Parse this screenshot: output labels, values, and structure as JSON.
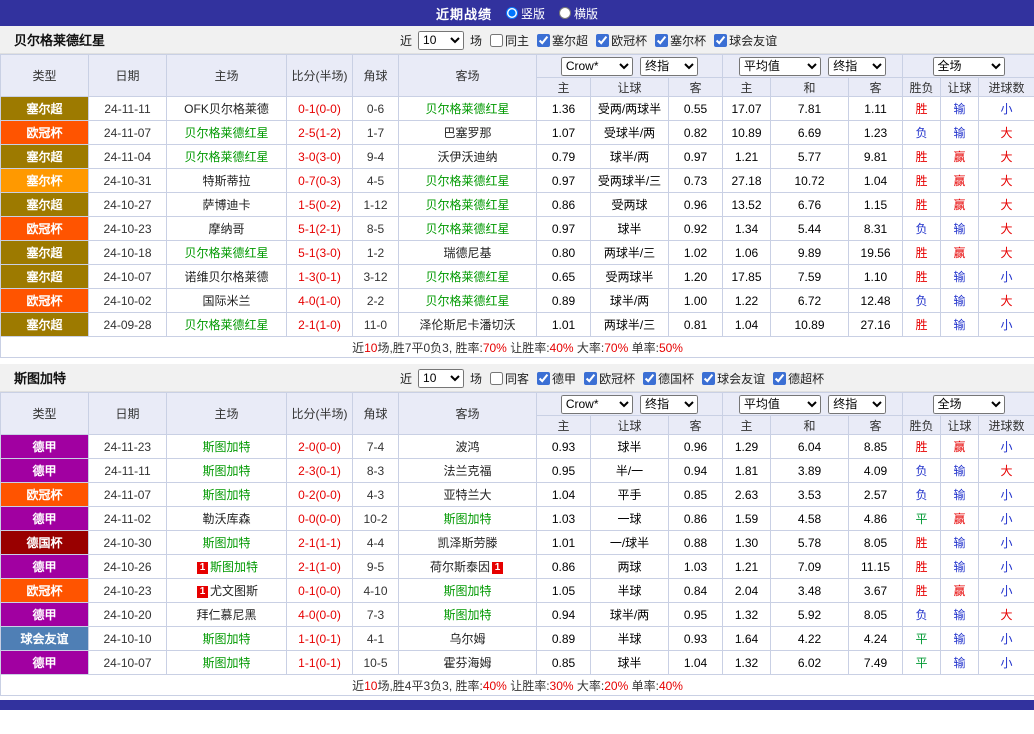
{
  "topbar": {
    "title": "近期战绩",
    "vertical": "竖版",
    "horizontal": "横版"
  },
  "card_text": "1",
  "colors": {
    "league": {
      "塞尔超": "#9d7a00",
      "欧冠杯": "#ff5400",
      "塞尔杯": "#ff9900",
      "德甲": "#a100a1",
      "德国杯": "#990000",
      "球会友谊": "#4f7fb5"
    },
    "result": {
      "胜": "#e60000",
      "负": "#2233cc",
      "平": "#009933",
      "赢": "#e60000",
      "输": "#2233cc",
      "大": "#e60000",
      "小": "#2233cc"
    }
  },
  "sections": [
    {
      "team": "贝尔格莱德红星",
      "filter": {
        "near": "近",
        "count": "10",
        "games": "场",
        "same": "同主",
        "leagues": [
          "塞尔超",
          "欧冠杯",
          "塞尔杯",
          "球会友谊"
        ]
      },
      "header": {
        "cols": [
          "类型",
          "日期",
          "主场",
          "比分(半场)",
          "角球",
          "客场"
        ],
        "company": "Crow*",
        "stage1": "终指",
        "avg": "平均值",
        "stage2": "终指",
        "scope": "全场",
        "sub": [
          "主",
          "让球",
          "客",
          "主",
          "和",
          "客"
        ],
        "res": [
          "胜负",
          "让球",
          "进球数"
        ]
      },
      "rows": [
        {
          "league": "塞尔超",
          "date": "24-11-11",
          "home": {
            "n": "OFK贝尔格莱德"
          },
          "score": "0-1(0-0)",
          "corner": "0-6",
          "away": {
            "n": "贝尔格莱德红星",
            "f": 1
          },
          "odds": [
            "1.36",
            "受两/两球半",
            "0.55",
            "17.07",
            "7.81",
            "1.11"
          ],
          "res": [
            "胜",
            "输",
            "小"
          ]
        },
        {
          "league": "欧冠杯",
          "date": "24-11-07",
          "home": {
            "n": "贝尔格莱德红星",
            "f": 1
          },
          "score": "2-5(1-2)",
          "corner": "1-7",
          "away": {
            "n": "巴塞罗那"
          },
          "odds": [
            "1.07",
            "受球半/两",
            "0.82",
            "10.89",
            "6.69",
            "1.23"
          ],
          "res": [
            "负",
            "输",
            "大"
          ]
        },
        {
          "league": "塞尔超",
          "date": "24-11-04",
          "home": {
            "n": "贝尔格莱德红星",
            "f": 1
          },
          "score": "3-0(3-0)",
          "corner": "9-4",
          "away": {
            "n": "沃伊沃迪纳"
          },
          "odds": [
            "0.79",
            "球半/两",
            "0.97",
            "1.21",
            "5.77",
            "9.81"
          ],
          "res": [
            "胜",
            "赢",
            "大"
          ]
        },
        {
          "league": "塞尔杯",
          "date": "24-10-31",
          "home": {
            "n": "特斯蒂拉"
          },
          "score": "0-7(0-3)",
          "corner": "4-5",
          "away": {
            "n": "贝尔格莱德红星",
            "f": 1
          },
          "odds": [
            "0.97",
            "受两球半/三",
            "0.73",
            "27.18",
            "10.72",
            "1.04"
          ],
          "res": [
            "胜",
            "赢",
            "大"
          ]
        },
        {
          "league": "塞尔超",
          "date": "24-10-27",
          "home": {
            "n": "萨博迪卡"
          },
          "score": "1-5(0-2)",
          "corner": "1-12",
          "away": {
            "n": "贝尔格莱德红星",
            "f": 1
          },
          "odds": [
            "0.86",
            "受两球",
            "0.96",
            "13.52",
            "6.76",
            "1.15"
          ],
          "res": [
            "胜",
            "赢",
            "大"
          ]
        },
        {
          "league": "欧冠杯",
          "date": "24-10-23",
          "home": {
            "n": "摩纳哥"
          },
          "score": "5-1(2-1)",
          "corner": "8-5",
          "away": {
            "n": "贝尔格莱德红星",
            "f": 1
          },
          "odds": [
            "0.97",
            "球半",
            "0.92",
            "1.34",
            "5.44",
            "8.31"
          ],
          "res": [
            "负",
            "输",
            "大"
          ]
        },
        {
          "league": "塞尔超",
          "date": "24-10-18",
          "home": {
            "n": "贝尔格莱德红星",
            "f": 1
          },
          "score": "5-1(3-0)",
          "corner": "1-2",
          "away": {
            "n": "瑞德尼基"
          },
          "odds": [
            "0.80",
            "两球半/三",
            "1.02",
            "1.06",
            "9.89",
            "19.56"
          ],
          "res": [
            "胜",
            "赢",
            "大"
          ]
        },
        {
          "league": "塞尔超",
          "date": "24-10-07",
          "home": {
            "n": "诺维贝尔格莱德"
          },
          "score": "1-3(0-1)",
          "corner": "3-12",
          "away": {
            "n": "贝尔格莱德红星",
            "f": 1
          },
          "odds": [
            "0.65",
            "受两球半",
            "1.20",
            "17.85",
            "7.59",
            "1.10"
          ],
          "res": [
            "胜",
            "输",
            "小"
          ]
        },
        {
          "league": "欧冠杯",
          "date": "24-10-02",
          "home": {
            "n": "国际米兰"
          },
          "score": "4-0(1-0)",
          "corner": "2-2",
          "away": {
            "n": "贝尔格莱德红星",
            "f": 1
          },
          "odds": [
            "0.89",
            "球半/两",
            "1.00",
            "1.22",
            "6.72",
            "12.48"
          ],
          "res": [
            "负",
            "输",
            "大"
          ]
        },
        {
          "league": "塞尔超",
          "date": "24-09-28",
          "home": {
            "n": "贝尔格莱德红星",
            "f": 1
          },
          "score": "2-1(1-0)",
          "corner": "11-0",
          "away": {
            "n": "泽伦斯尼卡潘切沃"
          },
          "odds": [
            "1.01",
            "两球半/三",
            "0.81",
            "1.04",
            "10.89",
            "27.16"
          ],
          "res": [
            "胜",
            "输",
            "小"
          ]
        }
      ],
      "summary": [
        {
          "t": "近"
        },
        {
          "t": "10",
          "r": 1
        },
        {
          "t": "场,胜7平0负3, 胜率:"
        },
        {
          "t": "70%",
          "r": 1
        },
        {
          "t": " 让胜率:"
        },
        {
          "t": "40%",
          "r": 1
        },
        {
          "t": " 大率:"
        },
        {
          "t": "70%",
          "r": 1
        },
        {
          "t": " 单率:"
        },
        {
          "t": "50%",
          "r": 1
        }
      ]
    },
    {
      "team": "斯图加特",
      "filter": {
        "near": "近",
        "count": "10",
        "games": "场",
        "same": "同客",
        "leagues": [
          "德甲",
          "欧冠杯",
          "德国杯",
          "球会友谊",
          "德超杯"
        ]
      },
      "header": {
        "cols": [
          "类型",
          "日期",
          "主场",
          "比分(半场)",
          "角球",
          "客场"
        ],
        "company": "Crow*",
        "stage1": "终指",
        "avg": "平均值",
        "stage2": "终指",
        "scope": "全场",
        "sub": [
          "主",
          "让球",
          "客",
          "主",
          "和",
          "客"
        ],
        "res": [
          "胜负",
          "让球",
          "进球数"
        ]
      },
      "rows": [
        {
          "league": "德甲",
          "date": "24-11-23",
          "home": {
            "n": "斯图加特",
            "f": 1
          },
          "score": "2-0(0-0)",
          "corner": "7-4",
          "away": {
            "n": "波鸿"
          },
          "odds": [
            "0.93",
            "球半",
            "0.96",
            "1.29",
            "6.04",
            "8.85"
          ],
          "res": [
            "胜",
            "赢",
            "小"
          ]
        },
        {
          "league": "德甲",
          "date": "24-11-11",
          "home": {
            "n": "斯图加特",
            "f": 1
          },
          "score": "2-3(0-1)",
          "corner": "8-3",
          "away": {
            "n": "法兰克福"
          },
          "odds": [
            "0.95",
            "半/一",
            "0.94",
            "1.81",
            "3.89",
            "4.09"
          ],
          "res": [
            "负",
            "输",
            "大"
          ]
        },
        {
          "league": "欧冠杯",
          "date": "24-11-07",
          "home": {
            "n": "斯图加特",
            "f": 1
          },
          "score": "0-2(0-0)",
          "corner": "4-3",
          "away": {
            "n": "亚特兰大"
          },
          "odds": [
            "1.04",
            "平手",
            "0.85",
            "2.63",
            "3.53",
            "2.57"
          ],
          "res": [
            "负",
            "输",
            "小"
          ]
        },
        {
          "league": "德甲",
          "date": "24-11-02",
          "home": {
            "n": "勒沃库森"
          },
          "score": "0-0(0-0)",
          "corner": "10-2",
          "away": {
            "n": "斯图加特",
            "f": 1
          },
          "odds": [
            "1.03",
            "一球",
            "0.86",
            "1.59",
            "4.58",
            "4.86"
          ],
          "res": [
            "平",
            "赢",
            "小"
          ]
        },
        {
          "league": "德国杯",
          "date": "24-10-30",
          "home": {
            "n": "斯图加特",
            "f": 1
          },
          "score": "2-1(1-1)",
          "corner": "4-4",
          "away": {
            "n": "凯泽斯劳滕"
          },
          "odds": [
            "1.01",
            "一/球半",
            "0.88",
            "1.30",
            "5.78",
            "8.05"
          ],
          "res": [
            "胜",
            "输",
            "小"
          ]
        },
        {
          "league": "德甲",
          "date": "24-10-26",
          "home": {
            "n": "斯图加特",
            "f": 1,
            "card": "pre"
          },
          "score": "2-1(1-0)",
          "corner": "9-5",
          "away": {
            "n": "荷尔斯泰因",
            "card": "post"
          },
          "odds": [
            "0.86",
            "两球",
            "1.03",
            "1.21",
            "7.09",
            "11.15"
          ],
          "res": [
            "胜",
            "输",
            "小"
          ]
        },
        {
          "league": "欧冠杯",
          "date": "24-10-23",
          "home": {
            "n": "尤文图斯",
            "card": "pre"
          },
          "score": "0-1(0-0)",
          "corner": "4-10",
          "away": {
            "n": "斯图加特",
            "f": 1
          },
          "odds": [
            "1.05",
            "半球",
            "0.84",
            "2.04",
            "3.48",
            "3.67"
          ],
          "res": [
            "胜",
            "赢",
            "小"
          ]
        },
        {
          "league": "德甲",
          "date": "24-10-20",
          "home": {
            "n": "拜仁慕尼黑"
          },
          "score": "4-0(0-0)",
          "corner": "7-3",
          "away": {
            "n": "斯图加特",
            "f": 1
          },
          "odds": [
            "0.94",
            "球半/两",
            "0.95",
            "1.32",
            "5.92",
            "8.05"
          ],
          "res": [
            "负",
            "输",
            "大"
          ]
        },
        {
          "league": "球会友谊",
          "date": "24-10-10",
          "home": {
            "n": "斯图加特",
            "f": 1
          },
          "score": "1-1(0-1)",
          "corner": "4-1",
          "away": {
            "n": "乌尔姆"
          },
          "odds": [
            "0.89",
            "半球",
            "0.93",
            "1.64",
            "4.22",
            "4.24"
          ],
          "res": [
            "平",
            "输",
            "小"
          ]
        },
        {
          "league": "德甲",
          "date": "24-10-07",
          "home": {
            "n": "斯图加特",
            "f": 1
          },
          "score": "1-1(0-1)",
          "corner": "10-5",
          "away": {
            "n": "霍芬海姆"
          },
          "odds": [
            "0.85",
            "球半",
            "1.04",
            "1.32",
            "6.02",
            "7.49"
          ],
          "res": [
            "平",
            "输",
            "小"
          ]
        }
      ],
      "summary": [
        {
          "t": "近"
        },
        {
          "t": "10",
          "r": 1
        },
        {
          "t": "场,胜4平3负3, 胜率:"
        },
        {
          "t": "40%",
          "r": 1
        },
        {
          "t": " 让胜率:"
        },
        {
          "t": "30%",
          "r": 1
        },
        {
          "t": " 大率:"
        },
        {
          "t": "20%",
          "r": 1
        },
        {
          "t": " 单率:"
        },
        {
          "t": "40%",
          "r": 1
        }
      ]
    }
  ]
}
